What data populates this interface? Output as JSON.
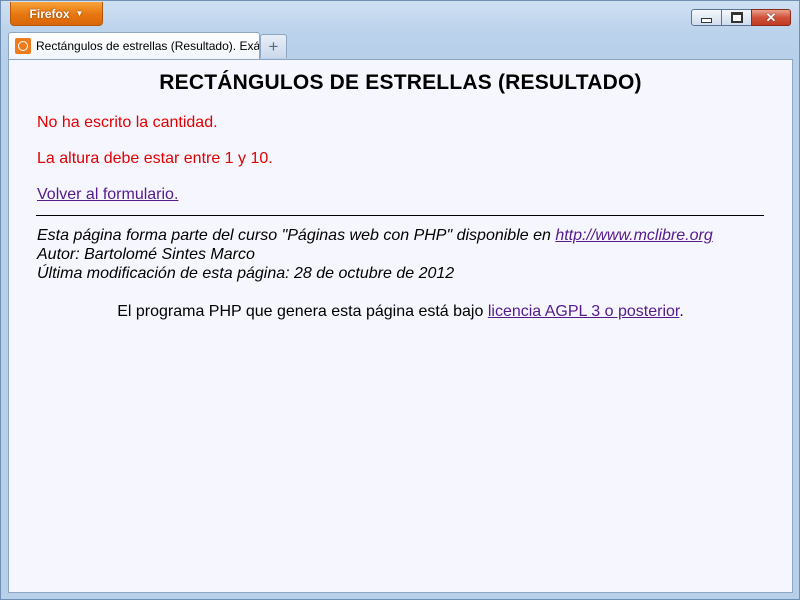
{
  "browser": {
    "menu_button_label": "Firefox",
    "tab_title": "Rectángulos de estrellas (Resultado). Exá...",
    "new_tab_label": "+"
  },
  "page": {
    "heading": "RECTÁNGULOS DE ESTRELLAS (RESULTADO)",
    "errors": [
      "No ha escrito la cantidad.",
      "La altura debe estar entre 1 y 10."
    ],
    "back_link": "Volver al formulario.",
    "footer": {
      "course_prefix": "Esta página forma parte del curso \"Páginas web con PHP\" disponible en ",
      "course_link": "http://www.mclibre.org",
      "author": "Autor: Bartolomé Sintes Marco",
      "modified": "Última modificación de esta página: 28 de octubre de 2012"
    },
    "license": {
      "prefix": "El programa PHP que genera esta página está bajo ",
      "link": "licencia AGPL 3 o posterior",
      "suffix": "."
    }
  }
}
